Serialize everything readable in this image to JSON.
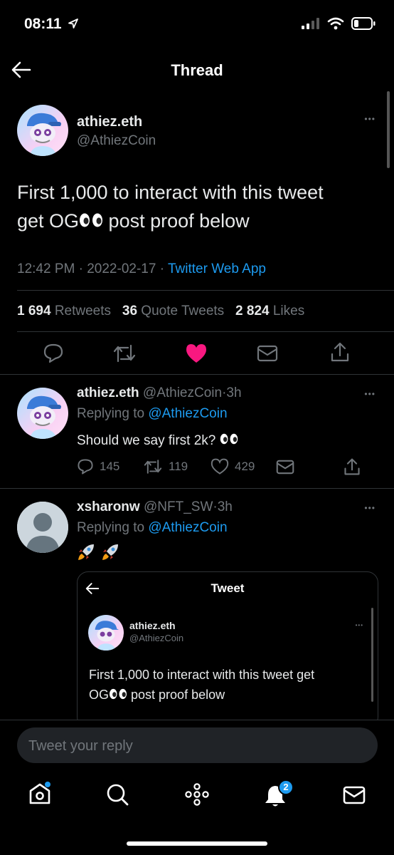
{
  "status_bar": {
    "time": "08:11"
  },
  "header": {
    "title": "Thread"
  },
  "main_tweet": {
    "display_name": "athiez.eth",
    "handle": "@AthiezCoin",
    "more": "•••",
    "text_line1": "First 1,000 to interact with this tweet",
    "text_line2_pre": "get OG",
    "text_line2_post": " post proof below",
    "time": "12:42 PM",
    "sep": "·",
    "date": "2022-02-17",
    "source": "Twitter Web App",
    "retweets_count": "1 694",
    "retweets_label": "Retweets",
    "quotes_count": "36",
    "quotes_label": "Quote Tweets",
    "likes_count": "2 824",
    "likes_label": "Likes",
    "like_color": "#f91880"
  },
  "reply1": {
    "display_name": "athiez.eth",
    "handle": "@AthiezCoin",
    "sep": "·",
    "age": "3h",
    "replying_label": "Replying to",
    "replying_handle": "@AthiezCoin",
    "text": "Should we say first 2k?",
    "replies": "145",
    "retweets": "119",
    "likes": "429",
    "more": "•••"
  },
  "reply2": {
    "display_name": "xsharonw",
    "handle": "@NFT_SW",
    "sep": "·",
    "age": "3h",
    "replying_label": "Replying to",
    "replying_handle": "@AthiezCoin",
    "more": "•••",
    "embed": {
      "title": "Tweet",
      "display_name": "athiez.eth",
      "handle": "@AthiezCoin",
      "more": "•••",
      "text_line1": "First 1,000 to interact with this tweet get",
      "text_line2_pre": "OG",
      "text_line2_post": " post proof below"
    }
  },
  "reply_box": {
    "placeholder": "Tweet your reply"
  },
  "tabbar": {
    "notifications_badge": "2",
    "accent": "#1d9bf0"
  }
}
